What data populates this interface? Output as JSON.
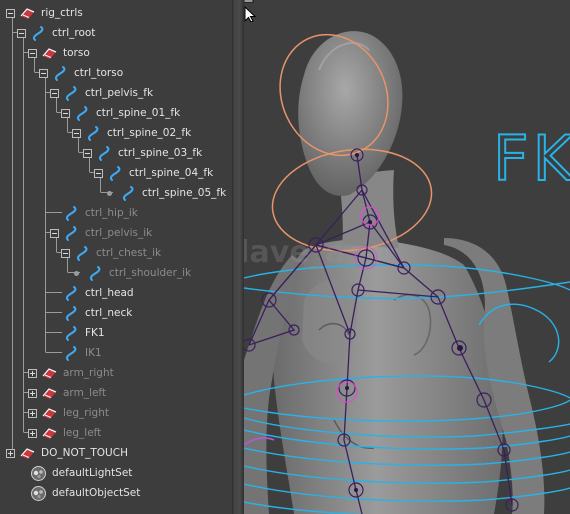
{
  "outliner": {
    "items": [
      {
        "label": "rig_ctrls",
        "icon": "transform-group-icon",
        "expander": "expanded",
        "dim": false
      },
      {
        "label": "ctrl_root",
        "icon": "nurbs-curve-icon",
        "expander": "expanded",
        "dim": false
      },
      {
        "label": "torso",
        "icon": "transform-group-icon",
        "expander": "expanded",
        "dim": false
      },
      {
        "label": "ctrl_torso",
        "icon": "nurbs-curve-icon",
        "expander": "expanded",
        "dim": false
      },
      {
        "label": "ctrl_pelvis_fk",
        "icon": "nurbs-curve-icon",
        "expander": "expanded",
        "dim": false
      },
      {
        "label": "ctrl_spine_01_fk",
        "icon": "nurbs-curve-icon",
        "expander": "expanded",
        "dim": false
      },
      {
        "label": "ctrl_spine_02_fk",
        "icon": "nurbs-curve-icon",
        "expander": "expanded",
        "dim": false
      },
      {
        "label": "ctrl_spine_03_fk",
        "icon": "nurbs-curve-icon",
        "expander": "expanded",
        "dim": false
      },
      {
        "label": "ctrl_spine_04_fk",
        "icon": "nurbs-curve-icon",
        "expander": "expanded",
        "dim": false
      },
      {
        "label": "ctrl_spine_05_fk",
        "icon": "nurbs-curve-icon",
        "expander": "leaf",
        "dim": false
      },
      {
        "label": "ctrl_hip_ik",
        "icon": "nurbs-curve-icon",
        "expander": "none",
        "dim": true
      },
      {
        "label": "ctrl_pelvis_ik",
        "icon": "nurbs-curve-icon",
        "expander": "expanded",
        "dim": true
      },
      {
        "label": "ctrl_chest_ik",
        "icon": "nurbs-curve-icon",
        "expander": "expanded",
        "dim": true
      },
      {
        "label": "ctrl_shoulder_ik",
        "icon": "nurbs-curve-icon",
        "expander": "leaf",
        "dim": true
      },
      {
        "label": "ctrl_head",
        "icon": "nurbs-curve-icon",
        "expander": "none",
        "dim": false
      },
      {
        "label": "ctrl_neck",
        "icon": "nurbs-curve-icon",
        "expander": "none",
        "dim": false
      },
      {
        "label": "FK1",
        "icon": "nurbs-curve-icon",
        "expander": "none",
        "dim": false
      },
      {
        "label": "IK1",
        "icon": "nurbs-curve-icon",
        "expander": "none",
        "dim": true
      },
      {
        "label": "arm_right",
        "icon": "transform-group-icon",
        "expander": "collapsed",
        "dim": true
      },
      {
        "label": "arm_left",
        "icon": "transform-group-icon",
        "expander": "collapsed",
        "dim": true
      },
      {
        "label": "leg_right",
        "icon": "transform-group-icon",
        "expander": "collapsed",
        "dim": true
      },
      {
        "label": "leg_left",
        "icon": "transform-group-icon",
        "expander": "collapsed",
        "dim": true
      },
      {
        "label": "DO_NOT_TOUCH",
        "icon": "transform-group-icon",
        "expander": "collapsed",
        "dim": false
      },
      {
        "label": "defaultLightSet",
        "icon": "object-set-icon",
        "expander": "none",
        "dim": false
      },
      {
        "label": "defaultObjectSet",
        "icon": "object-set-icon",
        "expander": "none",
        "dim": false
      }
    ]
  },
  "viewport": {
    "fk_label": "FK",
    "watermark": "@dave_a",
    "colors": {
      "fk_curve": "#27b3e8",
      "ik_curve": "#e8946a",
      "joint": "#4a2a6e",
      "selected_joint": "#d84fd0",
      "mesh": "#8d8d8d"
    }
  },
  "colors": {
    "outliner_bg": "#3d3d3d",
    "text": "#e4e4e4",
    "text_dim": "#8c8c8c",
    "curve_icon": "#3fa9f5",
    "group_icon": "#d9363e"
  }
}
